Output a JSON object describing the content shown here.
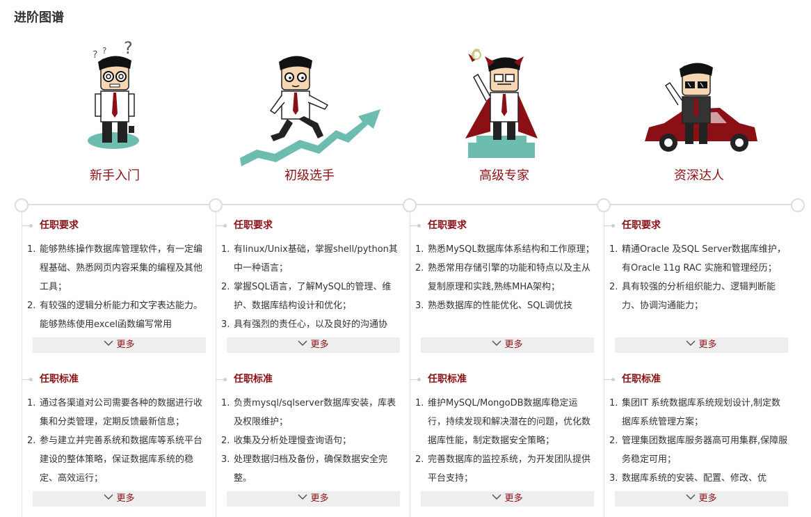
{
  "page_title": "进阶图谱",
  "colors": {
    "accent": "#8b1015",
    "teal": "#6cbcb0",
    "line": "#dddddd",
    "more_bg": "#eeeeee"
  },
  "stages": [
    {
      "name": "新手入门",
      "requirements": {
        "title": "任职要求",
        "items": [
          "能够熟练操作数据库管理软件，有一定编程基础、熟悉网页内容采集的编程及其他工具；",
          "有较强的逻辑分析能力和文字表达能力。能够熟练使用excel函数编写常用"
        ],
        "more": "更多"
      },
      "standards": {
        "title": "任职标准",
        "items": [
          "通过各渠道对公司需要各种的数据进行收集和分类管理，定期反馈最新信息；",
          "参与建立并完善系统和数据库等系统平台建设的整体策略，保证数据库系统的稳定、高效运行；"
        ],
        "more": "更多"
      }
    },
    {
      "name": "初级选手",
      "requirements": {
        "title": "任职要求",
        "items": [
          "有linux/Unix基础，掌握shell/python其中一种语言；",
          "掌握SQL语言，了解MySQL的管理、维护、数据库结构设计和优化；",
          "具有强烈的责任心，以及良好的沟通协"
        ],
        "more": "更多"
      },
      "standards": {
        "title": "任职标准",
        "items": [
          "负责mysql/sqlserver数据库安装，库表及权限维护；",
          "收集及分析处理慢查询语句；",
          "处理数据归档及备份，确保数据安全完整。"
        ],
        "more": "更多"
      }
    },
    {
      "name": "高级专家",
      "requirements": {
        "title": "任职要求",
        "items": [
          "熟悉MySQL数据库体系结构和工作原理；",
          "熟悉常用存储引擎的功能和特点以及主从复制原理和实践,熟练MHA架构；",
          "熟悉数据库的性能优化、SQL调优技"
        ],
        "more": "更多"
      },
      "standards": {
        "title": "任职标准",
        "items": [
          "维护MySQL/MongoDB数据库稳定运行，持续发现和解决潜在的问题，优化数据库性能，制定数据安全策略；",
          "完善数据库的监控系统，为开发团队提供平台支持；"
        ],
        "more": "更多"
      }
    },
    {
      "name": "资深达人",
      "requirements": {
        "title": "任职要求",
        "items": [
          "精通Oracle 及SQL Server数据库维护，有Oracle 11g RAC 实施和管理经历；",
          "具有较强的分析组织能力、逻辑判断能力、协调沟通能力；"
        ],
        "more": "更多"
      },
      "standards": {
        "title": "任职标准",
        "items": [
          "集团IT 系统数据库系统规划设计,制定数据库系统管理方案；",
          "管理集团数据库服务器高可用集群,保障服务稳定可用；",
          "数据库系统的安装、配置、修改、优"
        ],
        "more": "更多"
      }
    }
  ]
}
